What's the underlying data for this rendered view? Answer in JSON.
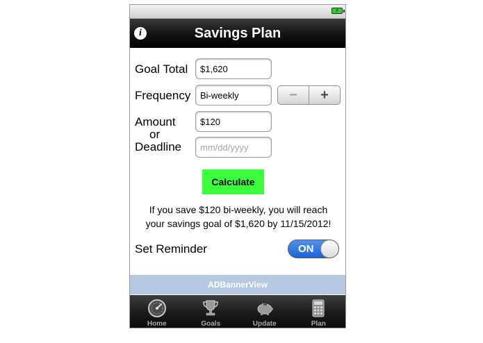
{
  "status_bar": {
    "battery_icon": "battery-charging-icon",
    "battery_glyph": "⚡",
    "battery_color": "#2fd12f"
  },
  "nav": {
    "title": "Savings Plan",
    "info_icon": "info-icon",
    "info_glyph": "i"
  },
  "form": {
    "goal_total": {
      "label": "Goal Total",
      "value": "$1,620"
    },
    "frequency": {
      "label": "Frequency",
      "value": "Bi-weekly",
      "stepper": {
        "minus": "−",
        "plus": "+"
      }
    },
    "amount": {
      "label": "Amount",
      "value": "$120"
    },
    "or_label": "or",
    "deadline": {
      "label": "Deadline",
      "value": "",
      "placeholder": "mm/dd/yyyy"
    }
  },
  "calculate_label": "Calculate",
  "calculate_color": "#3cff3c",
  "result": {
    "line1": "If you save $120 bi-weekly, you will reach",
    "line2": "your savings goal of $1,620 by 11/15/2012!"
  },
  "reminder": {
    "label": "Set Reminder",
    "state": "ON",
    "toggle_color": "#1a63d8"
  },
  "ad_banner": {
    "label": "ADBannerView",
    "color": "#b7c8e2"
  },
  "tabs": [
    {
      "label": "Home",
      "icon": "speedometer-icon"
    },
    {
      "label": "Goals",
      "icon": "trophy-icon"
    },
    {
      "label": "Update",
      "icon": "piggy-bank-icon"
    },
    {
      "label": "Plan",
      "icon": "calculator-icon"
    }
  ]
}
